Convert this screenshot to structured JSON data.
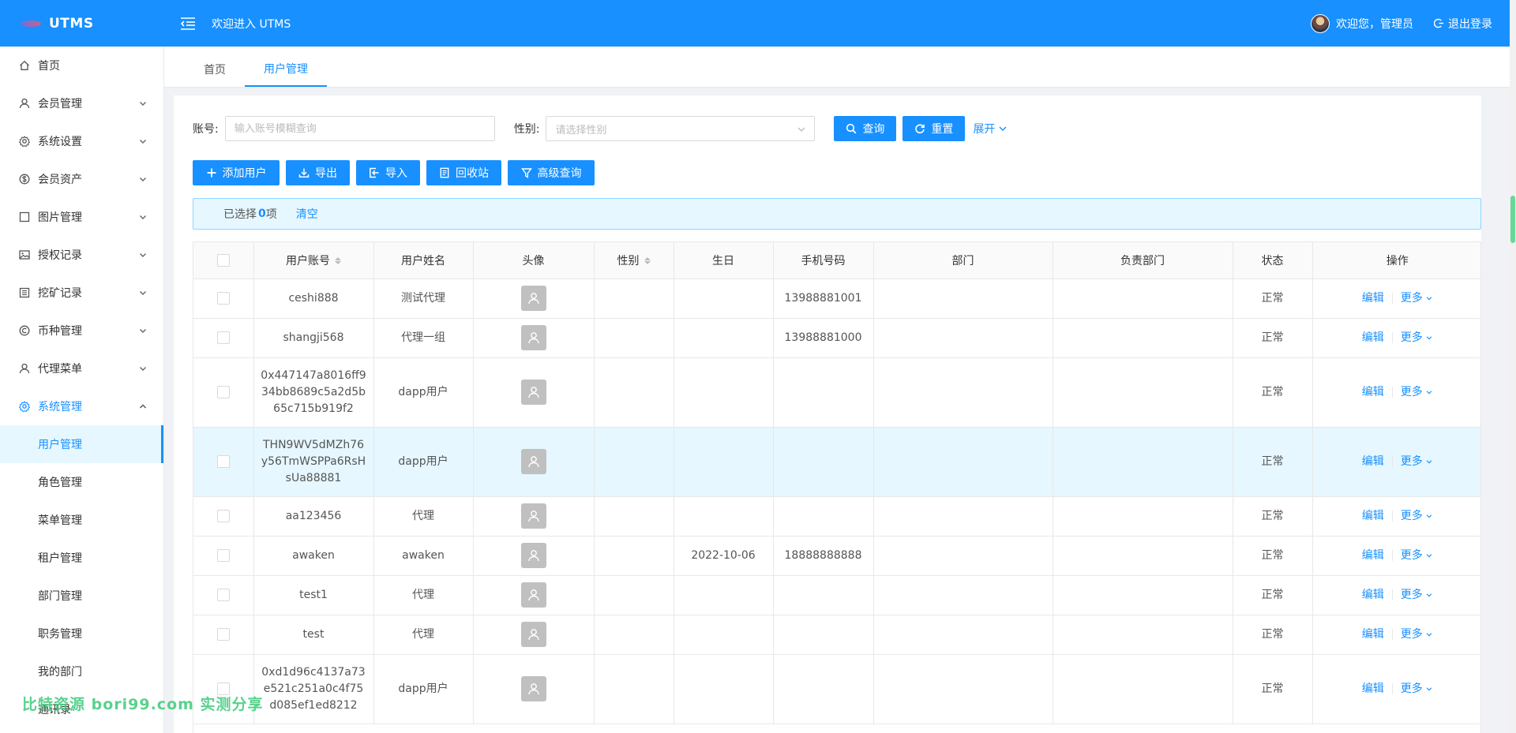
{
  "header": {
    "app_name": "UTMS",
    "welcome": "欢迎进入 UTMS",
    "user_greeting": "欢迎您，管理员",
    "logout": "退出登录",
    "brand_color": "#1890ff"
  },
  "sidebar": {
    "items": [
      {
        "label": "首页",
        "icon": "home-icon",
        "expandable": false
      },
      {
        "label": "会员管理",
        "icon": "user-icon",
        "expandable": true
      },
      {
        "label": "系统设置",
        "icon": "gear-icon",
        "expandable": true
      },
      {
        "label": "会员资产",
        "icon": "dollar-icon",
        "expandable": true
      },
      {
        "label": "图片管理",
        "icon": "square-icon",
        "expandable": true
      },
      {
        "label": "授权记录",
        "icon": "picture-icon",
        "expandable": true
      },
      {
        "label": "挖矿记录",
        "icon": "list-icon",
        "expandable": true
      },
      {
        "label": "币种管理",
        "icon": "copyright-icon",
        "expandable": true
      },
      {
        "label": "代理菜单",
        "icon": "user-icon",
        "expandable": true
      },
      {
        "label": "系统管理",
        "icon": "gear-icon",
        "expandable": true,
        "open": true
      }
    ],
    "sub_items": [
      "用户管理",
      "角色管理",
      "菜单管理",
      "租户管理",
      "部门管理",
      "职务管理",
      "我的部门",
      "通讯录"
    ],
    "active_sub": "用户管理"
  },
  "tabs": [
    {
      "label": "首页",
      "active": false
    },
    {
      "label": "用户管理",
      "active": true
    }
  ],
  "search": {
    "account_label": "账号:",
    "account_placeholder": "输入账号模糊查询",
    "gender_label": "性别:",
    "gender_placeholder": "请选择性别",
    "query_btn": "查询",
    "reset_btn": "重置",
    "expand_link": "展开"
  },
  "toolbar": {
    "add_user": "添加用户",
    "export": "导出",
    "import": "导入",
    "recycle": "回收站",
    "advanced": "高级查询"
  },
  "selection": {
    "prefix": "已选择",
    "count": "0",
    "suffix": "项",
    "clear": "清空"
  },
  "table": {
    "columns": [
      "用户账号",
      "用户姓名",
      "头像",
      "性别",
      "生日",
      "手机号码",
      "部门",
      "负责部门",
      "状态",
      "操作"
    ],
    "edit_label": "编辑",
    "more_label": "更多",
    "rows": [
      {
        "account": "ceshi888",
        "name": "测试代理",
        "gender": "",
        "birthday": "",
        "phone": "13988881001",
        "dept": "",
        "resp_dept": "",
        "status": "正常"
      },
      {
        "account": "shangji568",
        "name": "代理一组",
        "gender": "",
        "birthday": "",
        "phone": "13988881000",
        "dept": "",
        "resp_dept": "",
        "status": "正常"
      },
      {
        "account": "0x447147a8016ff934bb8689c5a2d5b65c715b919f2",
        "name": "dapp用户",
        "gender": "",
        "birthday": "",
        "phone": "",
        "dept": "",
        "resp_dept": "",
        "status": "正常"
      },
      {
        "account": "THN9WV5dMZh76y56TmWSPPa6RsHsUa88881",
        "name": "dapp用户",
        "gender": "",
        "birthday": "",
        "phone": "",
        "dept": "",
        "resp_dept": "",
        "status": "正常",
        "highlight": true
      },
      {
        "account": "aa123456",
        "name": "代理",
        "gender": "",
        "birthday": "",
        "phone": "",
        "dept": "",
        "resp_dept": "",
        "status": "正常"
      },
      {
        "account": "awaken",
        "name": "awaken",
        "gender": "",
        "birthday": "2022-10-06",
        "phone": "18888888888",
        "dept": "",
        "resp_dept": "",
        "status": "正常"
      },
      {
        "account": "test1",
        "name": "代理",
        "gender": "",
        "birthday": "",
        "phone": "",
        "dept": "",
        "resp_dept": "",
        "status": "正常"
      },
      {
        "account": "test",
        "name": "代理",
        "gender": "",
        "birthday": "",
        "phone": "",
        "dept": "",
        "resp_dept": "",
        "status": "正常"
      },
      {
        "account": "0xd1d96c4137a73e521c251a0c4f75d085ef1ed8212",
        "name": "dapp用户",
        "gender": "",
        "birthday": "",
        "phone": "",
        "dept": "",
        "resp_dept": "",
        "status": "正常"
      }
    ]
  },
  "watermark": "比特资源 bori99.com 实测分享"
}
